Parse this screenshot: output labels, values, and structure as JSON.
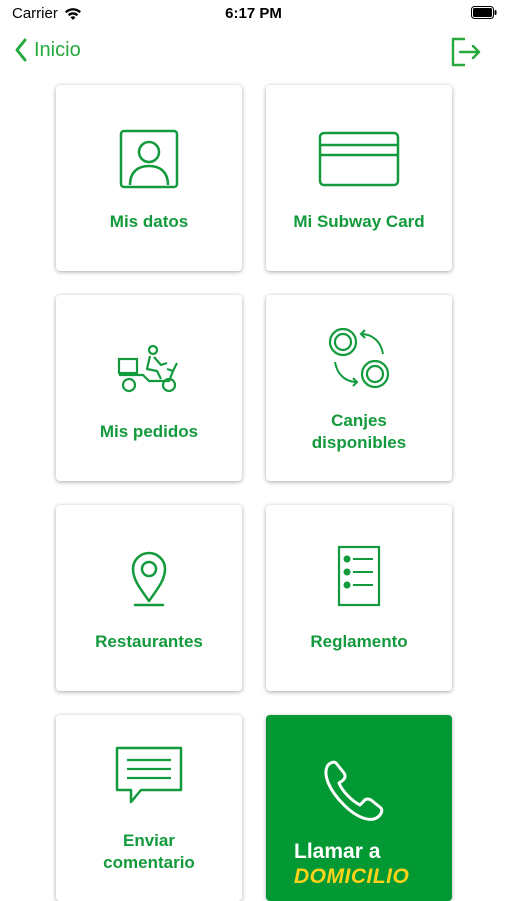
{
  "status_bar": {
    "carrier": "Carrier",
    "time": "6:17 PM"
  },
  "nav": {
    "back_label": "Inicio"
  },
  "tiles": [
    {
      "label": "Mis datos",
      "icon": "user-icon"
    },
    {
      "label": "Mi Subway Card",
      "icon": "card-icon"
    },
    {
      "label": "Mis pedidos",
      "icon": "delivery-scooter-icon"
    },
    {
      "label": "Canjes\ndisponibles",
      "icon": "coins-exchange-icon"
    },
    {
      "label": "Restaurantes",
      "icon": "location-pin-icon"
    },
    {
      "label": "Reglamento",
      "icon": "rules-list-icon"
    },
    {
      "label": "Enviar\ncomentario",
      "icon": "comment-icon"
    }
  ],
  "call": {
    "line1": "Llamar a",
    "line2": "DOMICILIO",
    "icon": "phone-icon"
  },
  "colors": {
    "accent": "#27a93d",
    "tile_text": "#139a3c",
    "call_bg": "#029833",
    "call_highlight": "#ffd21a"
  }
}
